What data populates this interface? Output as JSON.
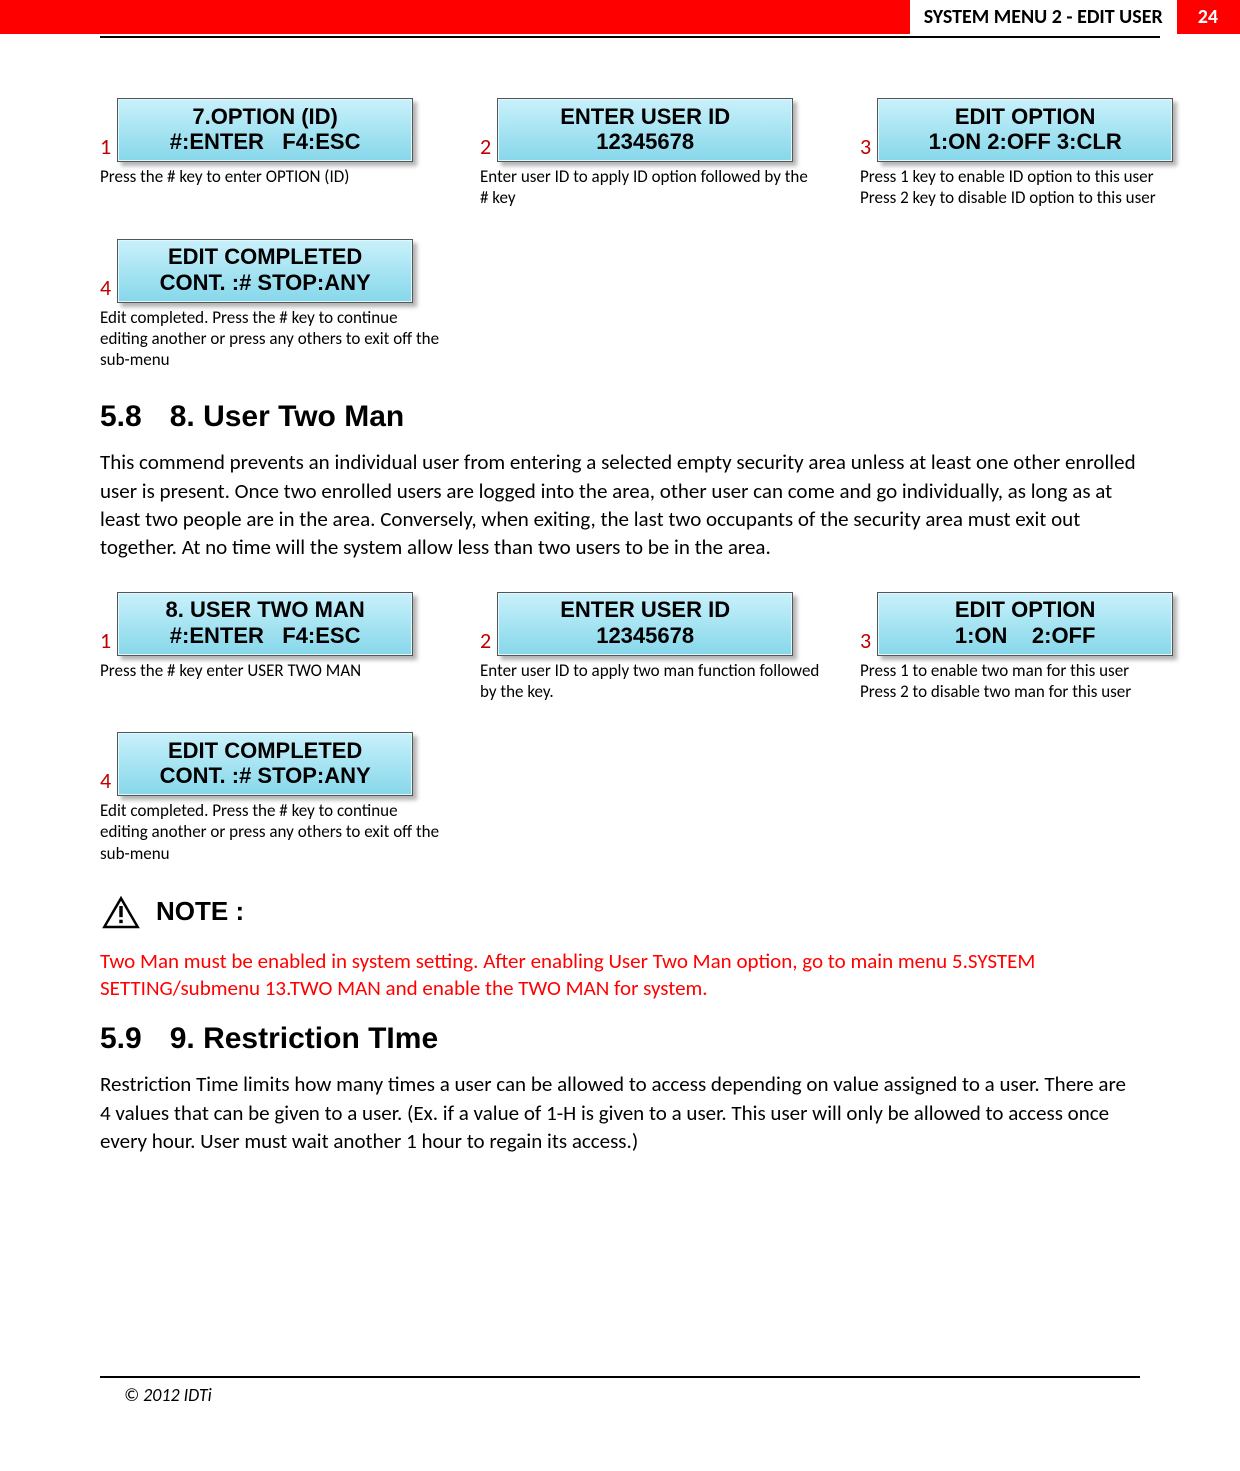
{
  "header": {
    "title": "SYSTEM MENU 2 - EDIT USER",
    "page_number": "24"
  },
  "group1": {
    "step1": {
      "num": "1",
      "line1": "7.OPTION (ID)",
      "line2": "#:ENTER   F4:ESC",
      "caption": "Press the # key to enter OPTION (ID)"
    },
    "step2": {
      "num": "2",
      "line1": "ENTER USER ID",
      "line2": "12345678",
      "caption": "Enter user ID to apply ID option followed by the # key"
    },
    "step3": {
      "num": "3",
      "line1": "EDIT OPTION",
      "line2": "1:ON 2:OFF 3:CLR",
      "caption": "Press 1 key to enable ID option to this user\nPress 2 key to disable ID option to this user"
    },
    "step4": {
      "num": "4",
      "line1": "EDIT COMPLETED",
      "line2": "CONT. :# STOP:ANY",
      "caption": "Edit completed. Press the # key to continue editing another or press any others to exit off the sub-menu"
    }
  },
  "section58": {
    "num": "5.8",
    "title": "8. User Two Man",
    "body": "This commend prevents an individual user from entering a selected empty security area unless at least one other enrolled user is present. Once two enrolled users are logged into the area, other user can come and go individually, as long as at least two people are in the area. Conversely, when exiting, the last two occupants of the security area must exit out together. At no time will the system allow less than two users to be in the area."
  },
  "group2": {
    "step1": {
      "num": "1",
      "line1": "8. USER TWO MAN",
      "line2": "#:ENTER   F4:ESC",
      "caption": "Press the # key enter USER TWO MAN"
    },
    "step2": {
      "num": "2",
      "line1": "ENTER USER ID",
      "line2": "12345678",
      "caption": "Enter user ID to apply two man function followed by the key."
    },
    "step3": {
      "num": "3",
      "line1": "EDIT OPTION",
      "line2": "1:ON    2:OFF",
      "caption": "Press 1 to enable two man for this user\nPress 2 to disable two man for this user"
    },
    "step4": {
      "num": "4",
      "line1": "EDIT COMPLETED",
      "line2": "CONT. :# STOP:ANY",
      "caption": "Edit completed. Press the # key to continue editing another or press any others to exit off the sub-menu"
    }
  },
  "note": {
    "label": "NOTE :",
    "text": "Two Man must be enabled in system setting. After enabling User Two Man option, go to main menu 5.SYSTEM SETTING/submenu 13.TWO MAN and enable the TWO MAN for system."
  },
  "section59": {
    "num": "5.9",
    "title": "9. Restriction TIme",
    "body": "Restriction Time limits how many times a user can be allowed to access depending on value assigned to a user. There are 4 values that can be given to a user. (Ex. if a value of 1-H is given to a user. This user will only be allowed to access once every hour. User must wait another 1 hour to regain its access.)"
  },
  "footer": {
    "copyright": "© 2012 IDTi"
  }
}
